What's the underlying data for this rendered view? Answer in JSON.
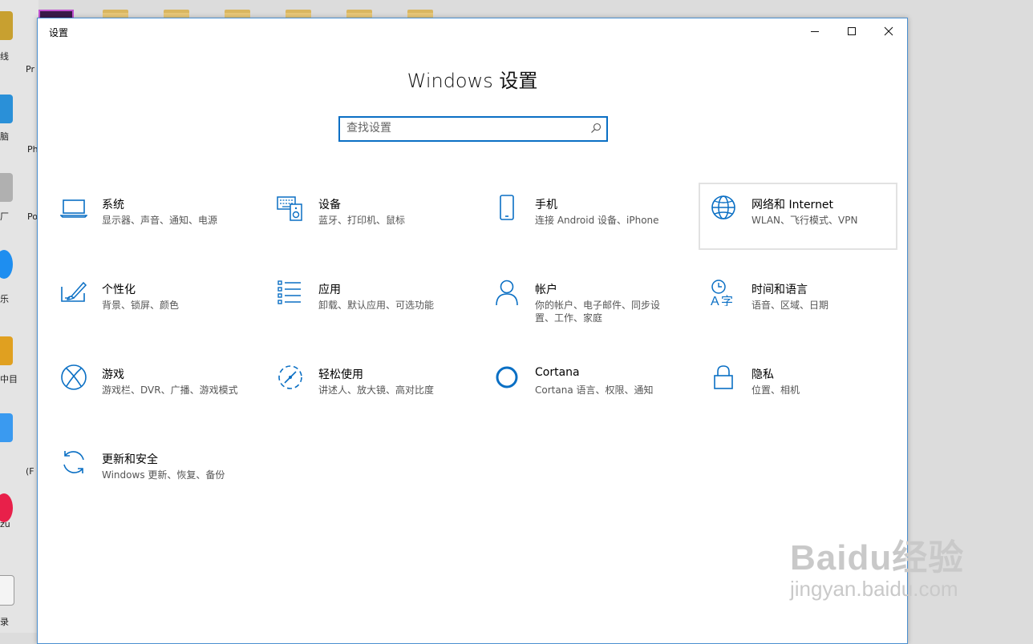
{
  "window": {
    "title": "设置",
    "heading": "Windows 设置"
  },
  "search": {
    "placeholder": "查找设置",
    "value": ""
  },
  "tiles": [
    {
      "title": "系统",
      "desc": "显示器、声音、通知、电源",
      "icon": "laptop-icon"
    },
    {
      "title": "设备",
      "desc": "蓝牙、打印机、鼠标",
      "icon": "keyboard-speaker-icon"
    },
    {
      "title": "手机",
      "desc": "连接 Android 设备、iPhone",
      "icon": "phone-icon"
    },
    {
      "title": "网络和 Internet",
      "desc": "WLAN、飞行模式、VPN",
      "icon": "globe-icon"
    },
    {
      "title": "个性化",
      "desc": "背景、锁屏、颜色",
      "icon": "paint-brush-icon"
    },
    {
      "title": "应用",
      "desc": "卸载、默认应用、可选功能",
      "icon": "app-list-icon"
    },
    {
      "title": "帐户",
      "desc": "你的帐户、电子邮件、同步设置、工作、家庭",
      "icon": "person-icon"
    },
    {
      "title": "时间和语言",
      "desc": "语音、区域、日期",
      "icon": "time-language-icon"
    },
    {
      "title": "游戏",
      "desc": "游戏栏、DVR、广播、游戏模式",
      "icon": "xbox-icon"
    },
    {
      "title": "轻松使用",
      "desc": "讲述人、放大镜、高对比度",
      "icon": "ease-of-access-icon"
    },
    {
      "title": "Cortana",
      "desc": "Cortana 语言、权限、通知",
      "icon": "cortana-ring-icon"
    },
    {
      "title": "隐私",
      "desc": "位置、相机",
      "icon": "lock-icon"
    },
    {
      "title": "更新和安全",
      "desc": "Windows 更新、恢复、备份",
      "icon": "refresh-icon"
    }
  ],
  "desktop_labels": [
    "线",
    "Pr",
    "脑",
    "Ph",
    "厂",
    "Po",
    "乐",
    "中目",
    "(F",
    "zu",
    "录"
  ],
  "watermark": {
    "brand": "Baidu经验",
    "url": "jingyan.baidu.com"
  },
  "colors": {
    "accent": "#0a6fc4",
    "hover_border": "#e2e2e2"
  }
}
